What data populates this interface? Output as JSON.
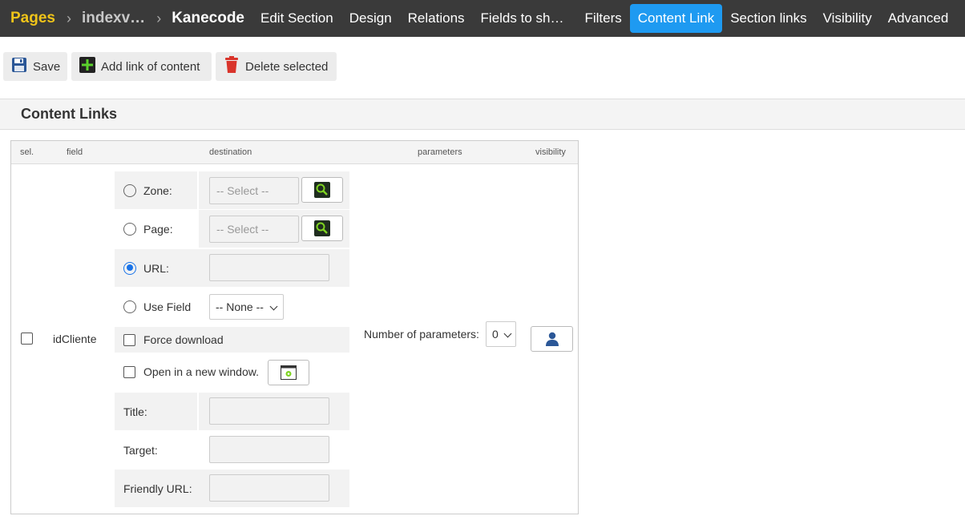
{
  "nav": {
    "crumb_pages": "Pages",
    "crumb_index": "indexv…",
    "crumb_section": "Kanecode",
    "tabs": [
      "Edit Section",
      "Design",
      "Relations",
      "Fields to sh…",
      "Filters",
      "Content Link",
      "Section links",
      "Visibility",
      "Advanced"
    ],
    "active_tab": "Content Link",
    "active_color": "#1e9af1",
    "accent_color": "#f0c419"
  },
  "toolbar": {
    "save": "Save",
    "add_link": "Add link of content",
    "delete_selected": "Delete selected"
  },
  "panel": {
    "title": "Content Links"
  },
  "grid": {
    "headers": {
      "sel": "sel.",
      "field": "field",
      "destination": "destination",
      "parameters": "parameters",
      "visibility": "visibility"
    },
    "row": {
      "field": "idCliente",
      "zone_label": "Zone:",
      "zone_placeholder": "-- Select --",
      "page_label": "Page:",
      "page_placeholder": "-- Select --",
      "url_label": "URL:",
      "url_value": "",
      "use_field_label": "Use Field",
      "use_field_value": "-- None --",
      "force_download_label": "Force download",
      "new_window_label": "Open in a new window.",
      "title_label": "Title:",
      "target_label": "Target:",
      "friendly_url_label": "Friendly URL:",
      "params_label": "Number of parameters:",
      "params_value": "0",
      "selected_destination": "URL"
    }
  }
}
